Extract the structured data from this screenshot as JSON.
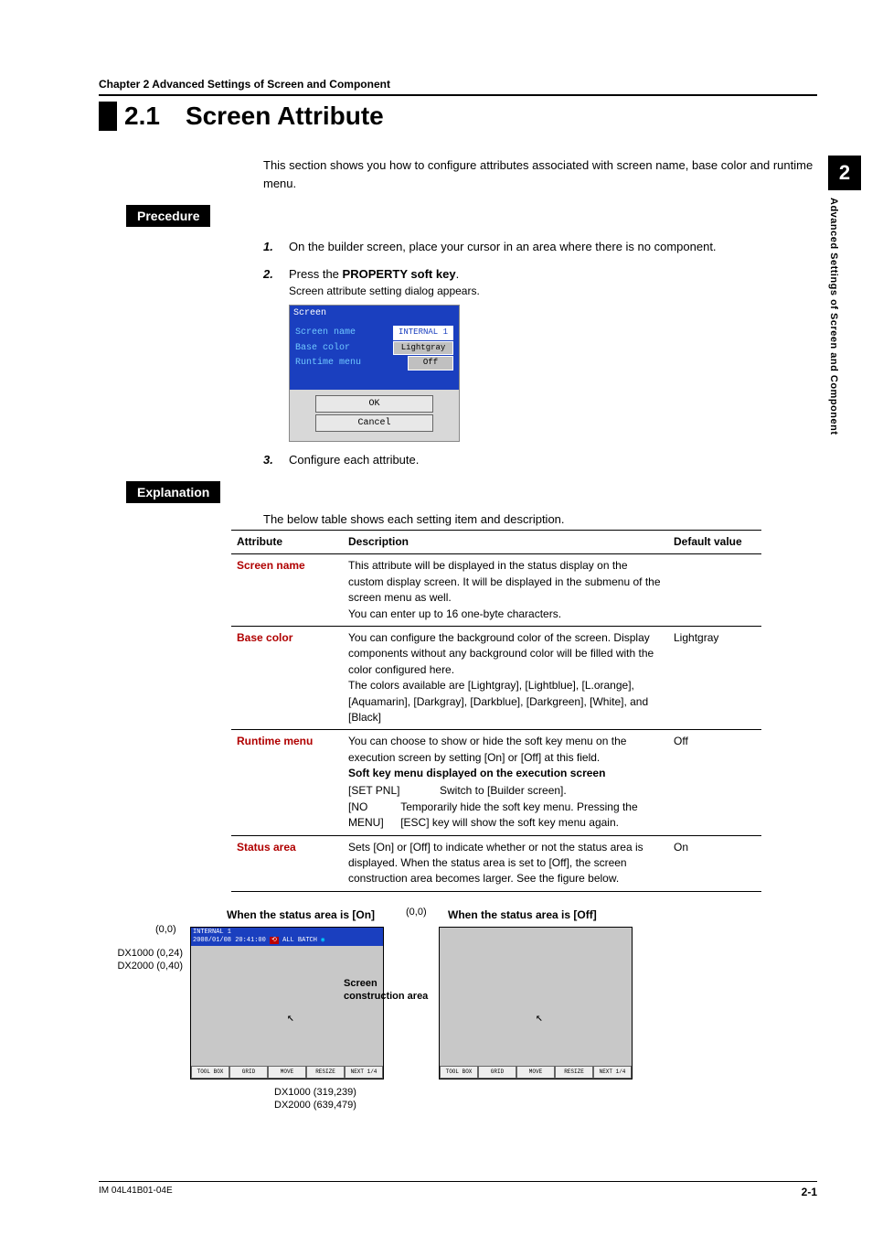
{
  "chapter_line": "Chapter 2    Advanced Settings of Screen and Component",
  "h1_num": "2.1",
  "h1_title": "Screen Attribute",
  "intro": "This section shows you how to configure attributes associated with screen name, base color and runtime menu.",
  "sec_precedure": "Precedure",
  "sec_explanation": "Explanation",
  "steps": {
    "s1": "On the builder screen, place your cursor in an area where there is no component.",
    "s2a": "Press the ",
    "s2b": "PROPERTY soft key",
    "s2c": ".",
    "s2sub": "Screen attribute setting dialog appears.",
    "s3": "Configure each attribute."
  },
  "dialog": {
    "title": "Screen",
    "r1k": "Screen name",
    "r1v": "INTERNAL 1",
    "r2k": "Base color",
    "r2v": "Lightgray",
    "r3k": "Runtime menu",
    "r3v": "Off",
    "ok": "OK",
    "cancel": "Cancel"
  },
  "table_intro": "The below table shows each setting item and description.",
  "th_attr": "Attribute",
  "th_desc": "Description",
  "th_def": "Default value",
  "rows": {
    "sn_name": "Screen name",
    "sn_desc1": "This attribute will be displayed in the status display on the custom display screen. It will be displayed in the submenu of the screen menu as well.",
    "sn_desc2": "You can enter up to 16 one-byte characters.",
    "sn_def": "",
    "bc_name": "Base color",
    "bc_desc1": "You can configure the background color of the screen. Display components without any background color will be filled with the color configured here.",
    "bc_desc2": "The colors available are [Lightgray], [Lightblue], [L.orange], [Aquamarin], [Darkgray], [Darkblue], [Darkgreen], [White], and [Black]",
    "bc_def": "Lightgray",
    "rm_name": "Runtime menu",
    "rm_desc1": "You can choose to show or hide the soft key menu on the execution screen by setting [On] or [Off] at this field.",
    "rm_desc2": "Soft key menu displayed on the execution screen",
    "rm_sk1k": "[SET PNL]",
    "rm_sk1v": "Switch to [Builder screen].",
    "rm_sk2k": "[NO MENU]",
    "rm_sk2v": "Temporarily hide the soft key menu. Pressing the [ESC] key will show the soft key menu again.",
    "rm_def": "Off",
    "sa_name": "Status area",
    "sa_desc": "Sets [On] or [Off] to indicate whether or not the status area is displayed. When the status area is set to [Off], the screen construction area becomes larger. See the figure below.",
    "sa_def": "On"
  },
  "fig": {
    "on_title": "When the status area is [On]",
    "off_title": "When the status area is [Off]",
    "c00": "(0,0)",
    "dx1": "DX1000 (0,24)",
    "dx2": "DX2000 (0,40)",
    "sca": "Screen construction area",
    "dx3": "DX1000 (319,239)",
    "dx4": "DX2000 (639,479)",
    "status_name": "INTERNAL 1",
    "status_time": "2008/01/08 20:41:00",
    "status_mode": "ALL BATCH",
    "sk": [
      "TOOL BOX",
      "GRID",
      "MOVE",
      "RESIZE",
      "NEXT 1/4"
    ]
  },
  "sidetab": {
    "num": "2",
    "text": "Advanced Settings of Screen and Component"
  },
  "footer": {
    "left": "IM 04L41B01-04E",
    "right": "2-1"
  }
}
